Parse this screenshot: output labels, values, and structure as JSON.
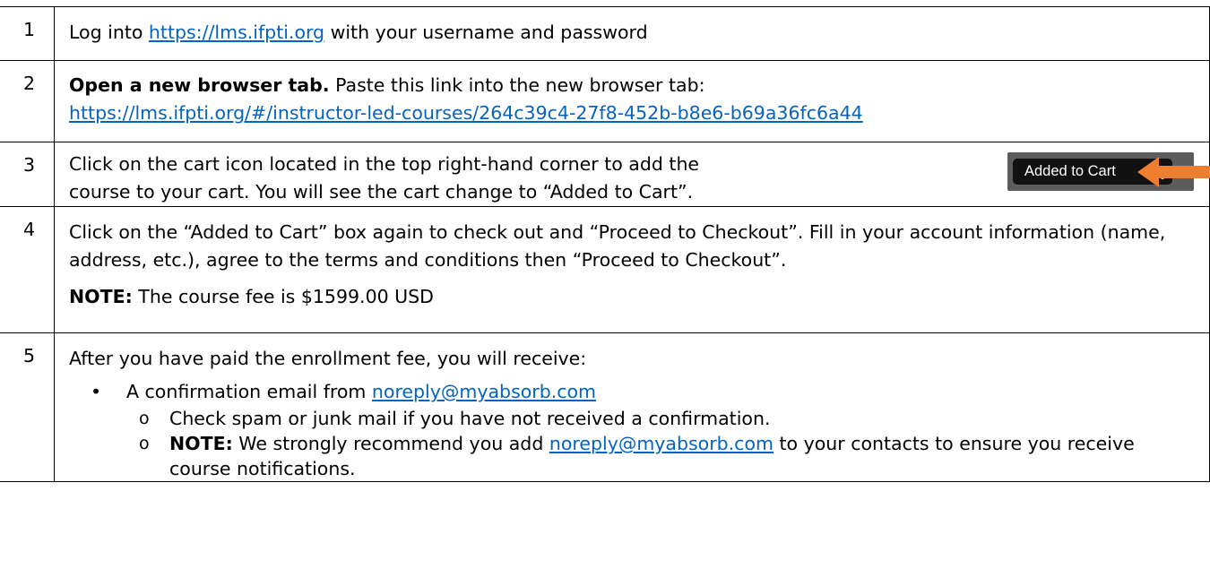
{
  "steps": [
    {
      "number": "1",
      "before": "Log into ",
      "link": "https://lms.ifpti.org",
      "after": " with your username and password"
    },
    {
      "number": "2",
      "bold": "Open a new browser tab.",
      "text": " Paste this link into the new browser tab:",
      "link": "https://lms.ifpti.org/#/instructor-led-courses/264c39c4-27f8-452b-b8e6-b69a36fc6a44"
    },
    {
      "number": "3",
      "line1": "Click on the cart icon located in the top right-hand corner to add the",
      "line2": "course to your cart. You will see the cart change to “Added to Cart”.",
      "image": {
        "button_label": "Added to Cart",
        "icon": "cart-icon",
        "arrow": "orange-arrow",
        "arrow_color": "#ed7d31"
      }
    },
    {
      "number": "4",
      "paragraph": "Click on the “Added to Cart” box again to check out and “Proceed to Checkout”. Fill in your account information (name, address, etc.), agree to the terms and conditions then “Proceed to Checkout”.",
      "note_label": "NOTE:",
      "note_text": " The course fee is $1599.00 USD"
    },
    {
      "number": "5",
      "intro": "After you have paid the enrollment fee, you will receive:",
      "bullet_symbol": "•",
      "bullet_text": "A confirmation email from ",
      "bullet_link": "noreply@myabsorb.com",
      "sub_marker": "o",
      "sub1": "Check spam or junk mail if you have not received a confirmation.",
      "sub2_label": "NOTE:",
      "sub2_before": " We strongly recommend you add ",
      "sub2_link": "noreply@myabsorb.com",
      "sub2_after": " to your contacts to ensure you receive course notifications."
    }
  ],
  "colors": {
    "link": "#0563c1",
    "arrow": "#ed7d31",
    "cart_bg": "#111111",
    "cart_frame": "#5c5c5c"
  }
}
